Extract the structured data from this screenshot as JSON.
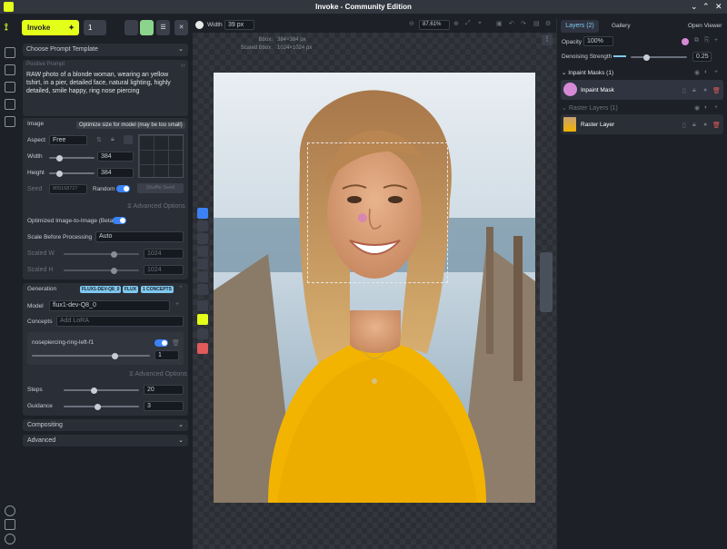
{
  "window": {
    "title": "Invoke - Community Edition"
  },
  "header": {
    "invoke_label": "Invoke",
    "queue_count": "1"
  },
  "canvas_toolbar": {
    "width_label": "Width",
    "width_value": "39 px",
    "zoom": "87.61%"
  },
  "bbox_info": {
    "bbox_label": "Bbox:",
    "bbox_value": "384×384 px",
    "scaled_label": "Scaled Bbox:",
    "scaled_value": "1024×1024 px"
  },
  "prompt": {
    "template_label": "Choose Prompt Template",
    "positive_label": "Positive Prompt",
    "text": "RAW photo of a blonde woman, wearing an yellow tshirt, in a pier, detailed face, natural lighting, highly detailed, smile happy, ring nose piercing"
  },
  "image_section": {
    "title": "Image",
    "tooltip": "Optimize size for model (may be too small)",
    "aspect_label": "Aspect",
    "aspect_value": "Free",
    "width_label": "Width",
    "width_value": "384",
    "height_label": "Height",
    "height_value": "384",
    "seed_label": "Seed",
    "seed_value": "805168727",
    "random_label": "Random",
    "shuffle_label": "Shuffle Seed",
    "advanced_label": "Advanced Options",
    "optimized_label": "Optimized Image-to-Image (Beta)",
    "scale_label": "Scale Before Processing",
    "scale_value": "Auto",
    "scaled_w_label": "Scaled W",
    "scaled_w_value": "1024",
    "scaled_h_label": "Scaled H",
    "scaled_h_value": "1024"
  },
  "generation": {
    "title": "Generation",
    "tags": [
      "FLUX1-DEV-Q8_0",
      "FLUX",
      "1 CONCEPTS"
    ],
    "model_label": "Model",
    "model_value": "flux1-dev-Q8_0",
    "concepts_label": "Concepts",
    "concepts_placeholder": "Add LoRA",
    "lora_name": "nosepiercing-ring-left-f1",
    "lora_weight": "1",
    "advanced_label": "Advanced Options",
    "steps_label": "Steps",
    "steps_value": "20",
    "guidance_label": "Guidance",
    "guidance_value": "3",
    "lora_slider_level": 0.7,
    "steps_slider_level": 0.4,
    "guidance_slider_level": 0.45
  },
  "sections": {
    "compositing": "Compositing",
    "advanced": "Advanced"
  },
  "right_panel": {
    "tab_layers": "Layers (2)",
    "tab_gallery": "Gallery",
    "open_viewer": "Open Viewer",
    "opacity_label": "Opacity",
    "opacity_value": "100%",
    "denoise_label": "Denoising Strength",
    "denoise_value": "0.25",
    "inpaint_group": "Inpaint Masks (1)",
    "inpaint_layer": "Inpaint Mask",
    "raster_group": "Raster Layers (1)",
    "raster_layer": "Raster Layer",
    "mask_color": "#d68ad6"
  },
  "colors": {
    "accent": "#e4ff1a",
    "toggle": "#3b82f6",
    "tag": "#7fc8ef"
  }
}
